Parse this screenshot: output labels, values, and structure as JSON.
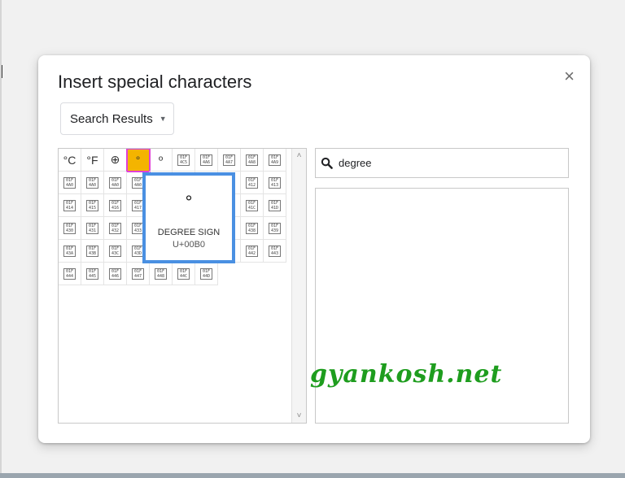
{
  "dialog": {
    "title": "Insert special characters",
    "close_label": "×",
    "category_label": "Search Results",
    "search_value": "degree"
  },
  "grid": {
    "rows": [
      [
        "°C",
        "°F",
        "⊕",
        "°",
        "º",
        "01F\n4C5",
        "01F\n4A6",
        "01F\n4A7",
        "01F\n4A8",
        "01F\n4A9"
      ],
      [
        "01F\n4A0",
        "01F\n4A0",
        "01F\n4A0",
        "01F\n4A0",
        "",
        "",
        "",
        "",
        "01F\n412",
        "01F\n413"
      ],
      [
        "01F\n414",
        "01F\n415",
        "01F\n416",
        "01F\n417",
        "",
        "",
        "",
        "",
        "01F\n41C",
        "01F\n41D"
      ],
      [
        "01F\n430",
        "01F\n431",
        "01F\n432",
        "01F\n433",
        "",
        "",
        "",
        "",
        "01F\n438",
        "01F\n439"
      ],
      [
        "01F\n43A",
        "01F\n43B",
        "01F\n43C",
        "01F\n43D",
        "",
        "",
        "",
        "",
        "01F\n442",
        "01F\n443"
      ],
      [
        "01F\n444",
        "01F\n445",
        "01F\n446",
        "01F\n447",
        "01F\n448",
        "01F\n44C",
        "01F\n44D"
      ]
    ],
    "selected_row": 0,
    "selected_col": 3
  },
  "preview": {
    "glyph": "°",
    "name": "DEGREE SIGN",
    "code": "U+00B0"
  },
  "watermark": "gyankosh.net",
  "colors": {
    "selected_fill": "#f4b400",
    "selected_outline": "#e040d8",
    "preview_border": "#4a90e2",
    "watermark": "#1e9d1e"
  }
}
